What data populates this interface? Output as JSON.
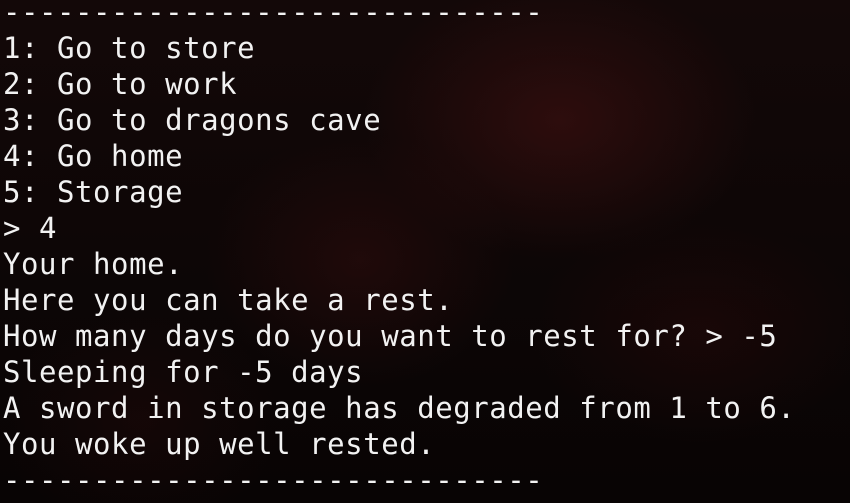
{
  "terminal": {
    "lines": [
      "------------------------------",
      "1: Go to store",
      "2: Go to work",
      "3: Go to dragons cave",
      "4: Go home",
      "5: Storage",
      "> 4",
      "Your home.",
      "Here you can take a rest.",
      "How many days do you want to rest for? > -5",
      "Sleeping for -5 days",
      "A sword in storage has degraded from 1 to 6.",
      "You woke up well rested.",
      "------------------------------"
    ]
  },
  "colors": {
    "text": "#f2f2f2",
    "background": "#0b0606"
  }
}
